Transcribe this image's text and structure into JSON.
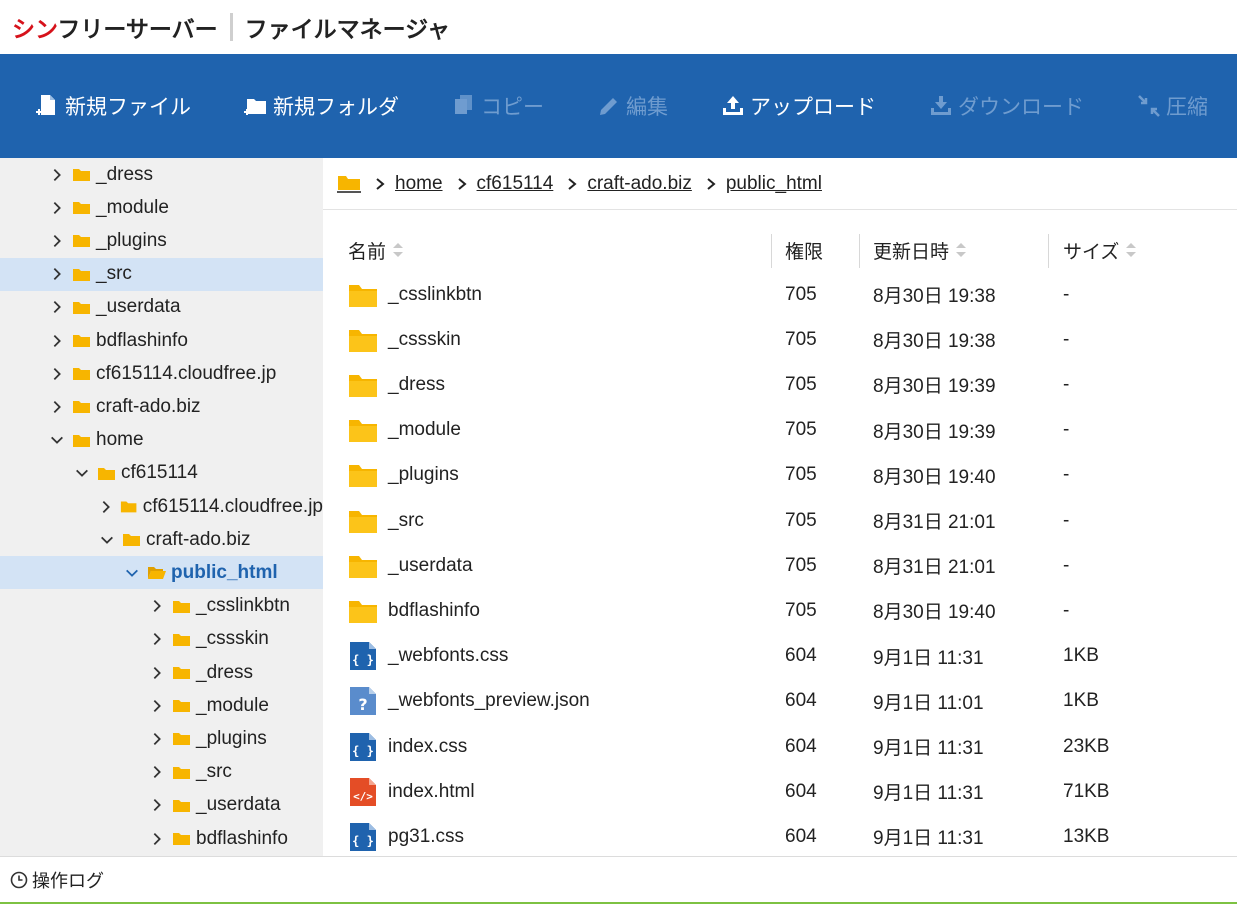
{
  "brand": {
    "name_red": "シン",
    "name_rest": "フリーサーバー",
    "app_title": "ファイルマネージャ"
  },
  "toolbar": [
    {
      "label": "新規ファイル",
      "icon": "new-file-icon",
      "enabled": true
    },
    {
      "label": "新規フォルダ",
      "icon": "new-folder-icon",
      "enabled": true
    },
    {
      "label": "コピー",
      "icon": "copy-icon",
      "enabled": false
    },
    {
      "label": "編集",
      "icon": "pencil-icon",
      "enabled": false
    },
    {
      "label": "アップロード",
      "icon": "upload-icon",
      "enabled": true
    },
    {
      "label": "ダウンロード",
      "icon": "download-icon",
      "enabled": false
    },
    {
      "label": "圧縮",
      "icon": "compress-icon",
      "enabled": false
    }
  ],
  "tree": [
    {
      "label": "_dress",
      "level": 0,
      "expanded": false
    },
    {
      "label": "_module",
      "level": 0,
      "expanded": false
    },
    {
      "label": "_plugins",
      "level": 0,
      "expanded": false
    },
    {
      "label": "_src",
      "level": 0,
      "expanded": false,
      "selected": true
    },
    {
      "label": "_userdata",
      "level": 0,
      "expanded": false
    },
    {
      "label": "bdflashinfo",
      "level": 0,
      "expanded": false
    },
    {
      "label": "cf615114.cloudfree.jp",
      "level": 0,
      "expanded": false
    },
    {
      "label": "craft-ado.biz",
      "level": 0,
      "expanded": false
    },
    {
      "label": "home",
      "level": 0,
      "expanded": true
    },
    {
      "label": "cf615114",
      "level": 1,
      "expanded": true
    },
    {
      "label": "cf615114.cloudfree.jp",
      "level": 2,
      "expanded": false
    },
    {
      "label": "craft-ado.biz",
      "level": 2,
      "expanded": true
    },
    {
      "label": "public_html",
      "level": 3,
      "expanded": true,
      "current": true
    },
    {
      "label": "_csslinkbtn",
      "level": 4,
      "expanded": false
    },
    {
      "label": "_cssskin",
      "level": 4,
      "expanded": false
    },
    {
      "label": "_dress",
      "level": 4,
      "expanded": false
    },
    {
      "label": "_module",
      "level": 4,
      "expanded": false
    },
    {
      "label": "_plugins",
      "level": 4,
      "expanded": false
    },
    {
      "label": "_src",
      "level": 4,
      "expanded": false
    },
    {
      "label": "_userdata",
      "level": 4,
      "expanded": false
    },
    {
      "label": "bdflashinfo",
      "level": 4,
      "expanded": false
    }
  ],
  "breadcrumb": [
    "home",
    "cf615114",
    "craft-ado.biz",
    "public_html"
  ],
  "columns": {
    "name": "名前",
    "perm": "権限",
    "date": "更新日時",
    "size": "サイズ"
  },
  "files": [
    {
      "name": "_csslinkbtn",
      "type": "folder",
      "perm": "705",
      "date": "8月30日 19:38",
      "size": "-"
    },
    {
      "name": "_cssskin",
      "type": "folder",
      "perm": "705",
      "date": "8月30日 19:38",
      "size": "-"
    },
    {
      "name": "_dress",
      "type": "folder",
      "perm": "705",
      "date": "8月30日 19:39",
      "size": "-"
    },
    {
      "name": "_module",
      "type": "folder",
      "perm": "705",
      "date": "8月30日 19:39",
      "size": "-"
    },
    {
      "name": "_plugins",
      "type": "folder",
      "perm": "705",
      "date": "8月30日 19:40",
      "size": "-"
    },
    {
      "name": "_src",
      "type": "folder",
      "perm": "705",
      "date": "8月31日 21:01",
      "size": "-"
    },
    {
      "name": "_userdata",
      "type": "folder",
      "perm": "705",
      "date": "8月31日 21:01",
      "size": "-"
    },
    {
      "name": "bdflashinfo",
      "type": "folder",
      "perm": "705",
      "date": "8月30日 19:40",
      "size": "-"
    },
    {
      "name": "_webfonts.css",
      "type": "css",
      "perm": "604",
      "date": "9月1日 11:31",
      "size": "1KB"
    },
    {
      "name": "_webfonts_preview.json",
      "type": "unknown",
      "perm": "604",
      "date": "9月1日 11:01",
      "size": "1KB"
    },
    {
      "name": "index.css",
      "type": "css",
      "perm": "604",
      "date": "9月1日 11:31",
      "size": "23KB"
    },
    {
      "name": "index.html",
      "type": "html",
      "perm": "604",
      "date": "9月1日 11:31",
      "size": "71KB"
    },
    {
      "name": "pg31.css",
      "type": "css",
      "perm": "604",
      "date": "9月1日 11:31",
      "size": "13KB"
    }
  ],
  "footer": {
    "label": "操作ログ"
  },
  "colors": {
    "toolbar_bg": "#1f63ae",
    "folder": "#f7b500",
    "brand_red": "#d6121b",
    "footer_accent": "#7dc242"
  }
}
